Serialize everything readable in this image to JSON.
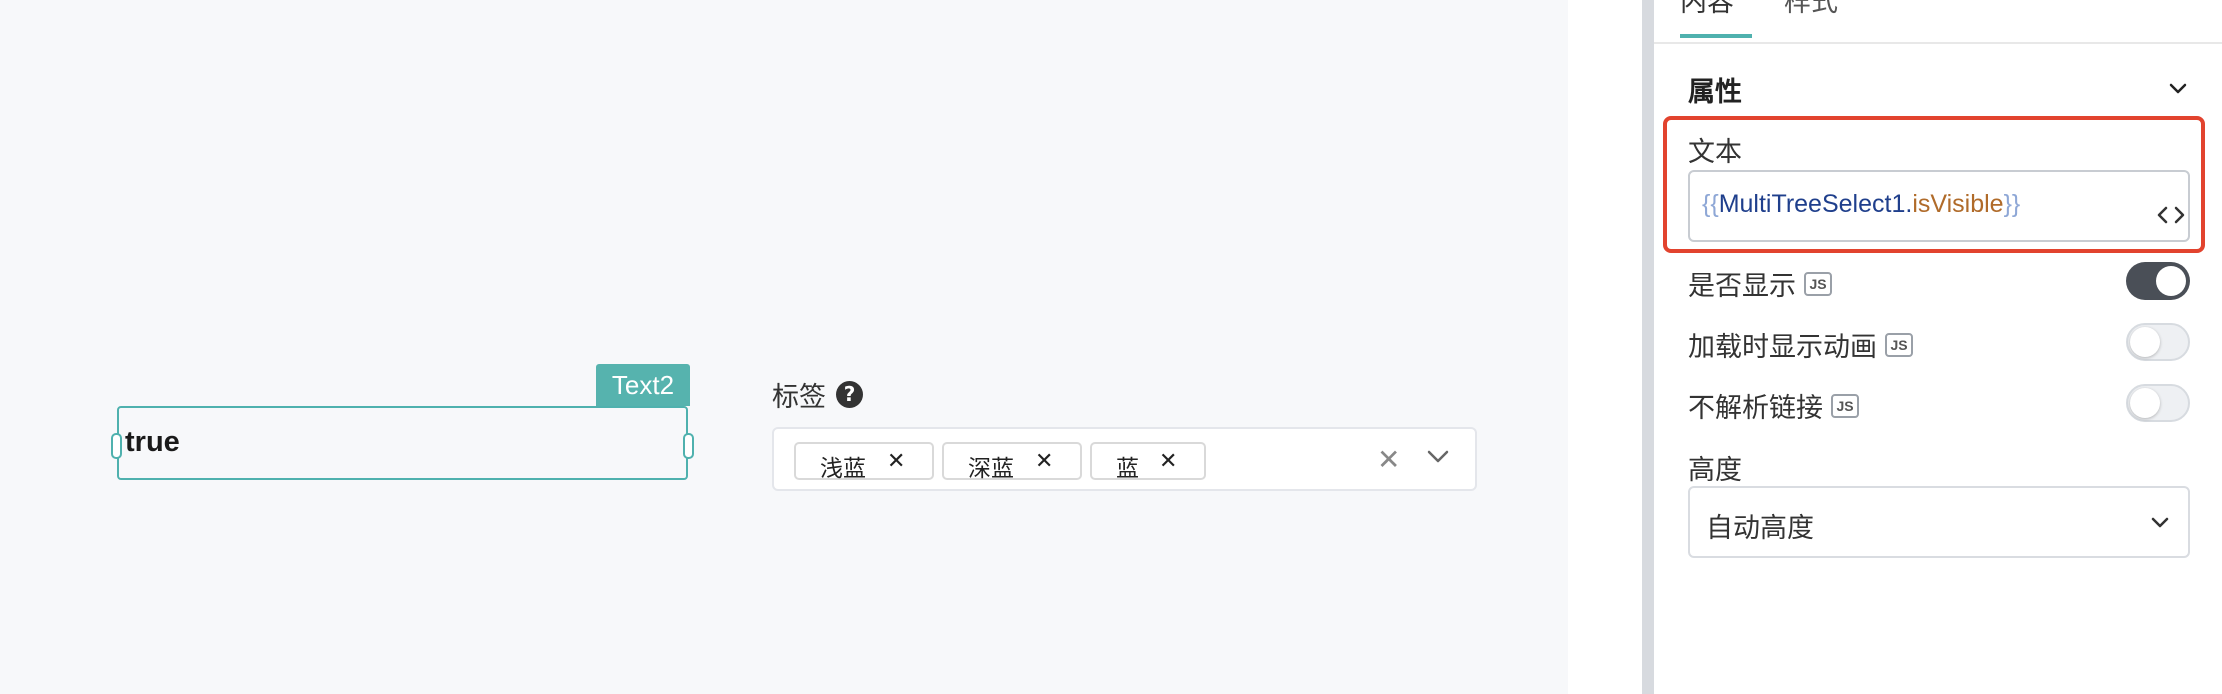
{
  "canvas": {
    "text_widget": {
      "value": "true",
      "name_tag": "Text2"
    },
    "tag_select": {
      "label": "标签",
      "help_icon": "?",
      "chips": [
        {
          "label": "浅蓝",
          "close": "✕"
        },
        {
          "label": "深蓝",
          "close": "✕"
        },
        {
          "label": "蓝",
          "close": "✕"
        }
      ],
      "clear_icon": "✕"
    }
  },
  "panel": {
    "tabs": [
      {
        "label": "内容",
        "active": true
      },
      {
        "label": "样式",
        "active": false
      }
    ],
    "section_title": "属性",
    "text_field": {
      "label": "文本",
      "open_brace": "{{",
      "object": "MultiTreeSelect1",
      "dot": ".",
      "property": "isVisible",
      "close_brace": "}}"
    },
    "switches": [
      {
        "label": "是否显示",
        "badge": "JS",
        "on": true
      },
      {
        "label": "加载时显示动画",
        "badge": "JS",
        "on": false
      },
      {
        "label": "不解析链接",
        "badge": "JS",
        "on": false
      }
    ],
    "height": {
      "label": "高度",
      "value": "自动高度"
    }
  },
  "colors": {
    "accent": "#4fb1ae",
    "highlight": "#e2432e",
    "switch_on": "#4a4f57"
  }
}
